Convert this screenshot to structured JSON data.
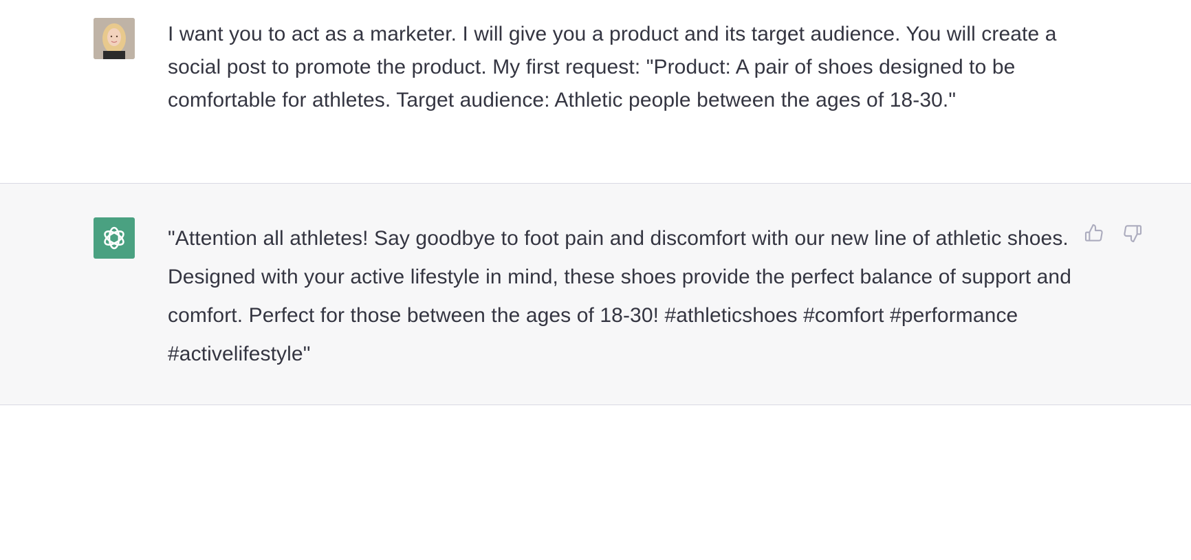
{
  "conversation": {
    "user_message": {
      "avatar": "user-avatar-photo",
      "text": "I want you to act as a marketer. I will give you a product and its target audience. You will create a social post to promote the product. My first request: \"Product: A pair of shoes designed to be comfortable for athletes. Target audience: Athletic people between the ages of 18-30.\""
    },
    "assistant_message": {
      "avatar": "openai-logo-icon",
      "text": "\"Attention all athletes! Say goodbye to foot pain and discomfort with our new line of athletic shoes. Designed with your active lifestyle in mind, these shoes provide the perfect balance of support and comfort. Perfect for those between the ages of 18-30! #athleticshoes #comfort #performance #activelifestyle\"",
      "feedback": {
        "thumbs_up_icon": "thumbs-up-icon",
        "thumbs_down_icon": "thumbs-down-icon"
      }
    }
  },
  "colors": {
    "text": "#343541",
    "assistant_bg": "#f7f7f8",
    "divider": "#d9d9e3",
    "bot_avatar_bg": "#4aa181",
    "icon_gray": "#acacbe"
  }
}
